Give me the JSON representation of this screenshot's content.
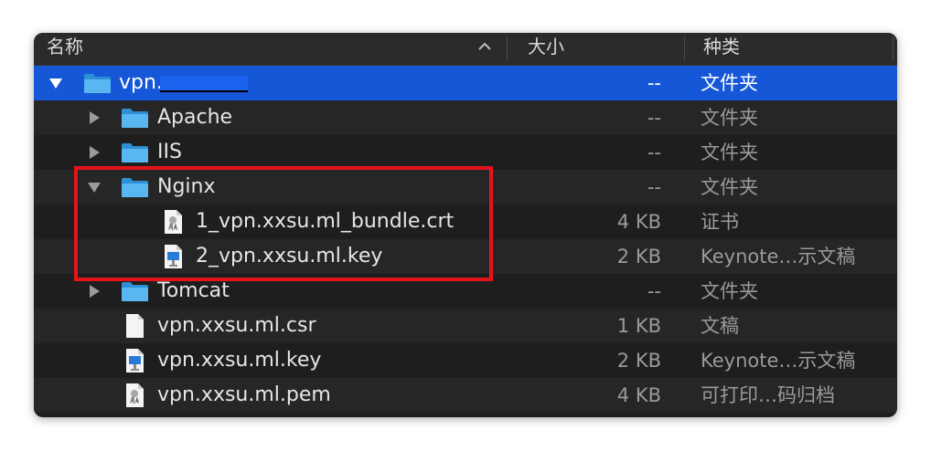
{
  "header": {
    "name_label": "名称",
    "size_label": "大小",
    "kind_label": "种类"
  },
  "rows": [
    {
      "name": "vpn.",
      "size": "--",
      "kind": "文件夹",
      "icon": "folder-icon",
      "disclosure": "expanded",
      "selected": true
    },
    {
      "name": "Apache",
      "size": "--",
      "kind": "文件夹",
      "icon": "folder-icon",
      "disclosure": "collapsed"
    },
    {
      "name": "IIS",
      "size": "--",
      "kind": "文件夹",
      "icon": "folder-icon",
      "disclosure": "collapsed"
    },
    {
      "name": "Nginx",
      "size": "--",
      "kind": "文件夹",
      "icon": "folder-icon",
      "disclosure": "expanded"
    },
    {
      "name": "1_vpn.xxsu.ml_bundle.crt",
      "size": "4 KB",
      "kind": "证书",
      "icon": "certificate-icon"
    },
    {
      "name": "2_vpn.xxsu.ml.key",
      "size": "2 KB",
      "kind": "Keynote…示文稿",
      "icon": "keynote-icon"
    },
    {
      "name": "Tomcat",
      "size": "--",
      "kind": "文件夹",
      "icon": "folder-icon",
      "disclosure": "collapsed"
    },
    {
      "name": "vpn.xxsu.ml.csr",
      "size": "1 KB",
      "kind": "文稿",
      "icon": "document-icon"
    },
    {
      "name": "vpn.xxsu.ml.key",
      "size": "2 KB",
      "kind": "Keynote…示文稿",
      "icon": "keynote-icon"
    },
    {
      "name": "vpn.xxsu.ml.pem",
      "size": "4 KB",
      "kind": "可打印…码归档",
      "icon": "certificate-icon"
    }
  ],
  "colors": {
    "selection": "#1657d8",
    "highlight_box": "#e5141b",
    "folder": "#3aa0e6"
  }
}
